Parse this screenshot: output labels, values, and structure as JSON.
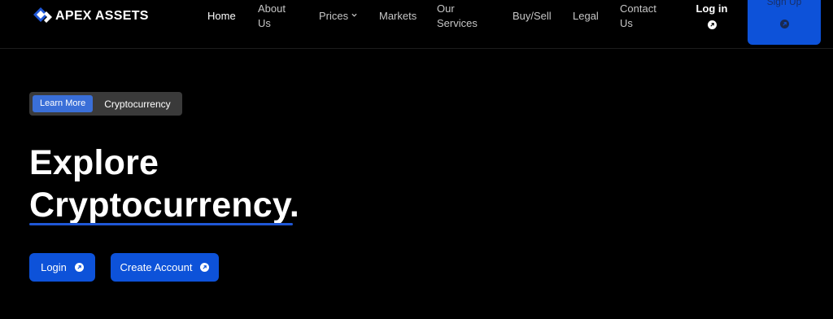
{
  "brand": {
    "name": "APEX ASSETS",
    "accent": "#0d52d9",
    "logo_icon": "diamond-logo-icon"
  },
  "nav": {
    "home": "Home",
    "about": "About Us",
    "prices": "Prices",
    "markets": "Markets",
    "services": "Our Services",
    "buysell": "Buy/Sell",
    "legal": "Legal",
    "contact": "Contact Us",
    "login": "Log in",
    "signup": "Sign Up"
  },
  "hero": {
    "badge_button": "Learn More",
    "badge_text": "Cryptocurrency",
    "title_line1": "Explore",
    "title_line2": "Cryptocurrency.",
    "login_button": "Login",
    "create_account_button": "Create Account"
  },
  "icons": {
    "arrow": "arrow-up-right-circle-icon",
    "chevron": "chevron-down-icon"
  }
}
